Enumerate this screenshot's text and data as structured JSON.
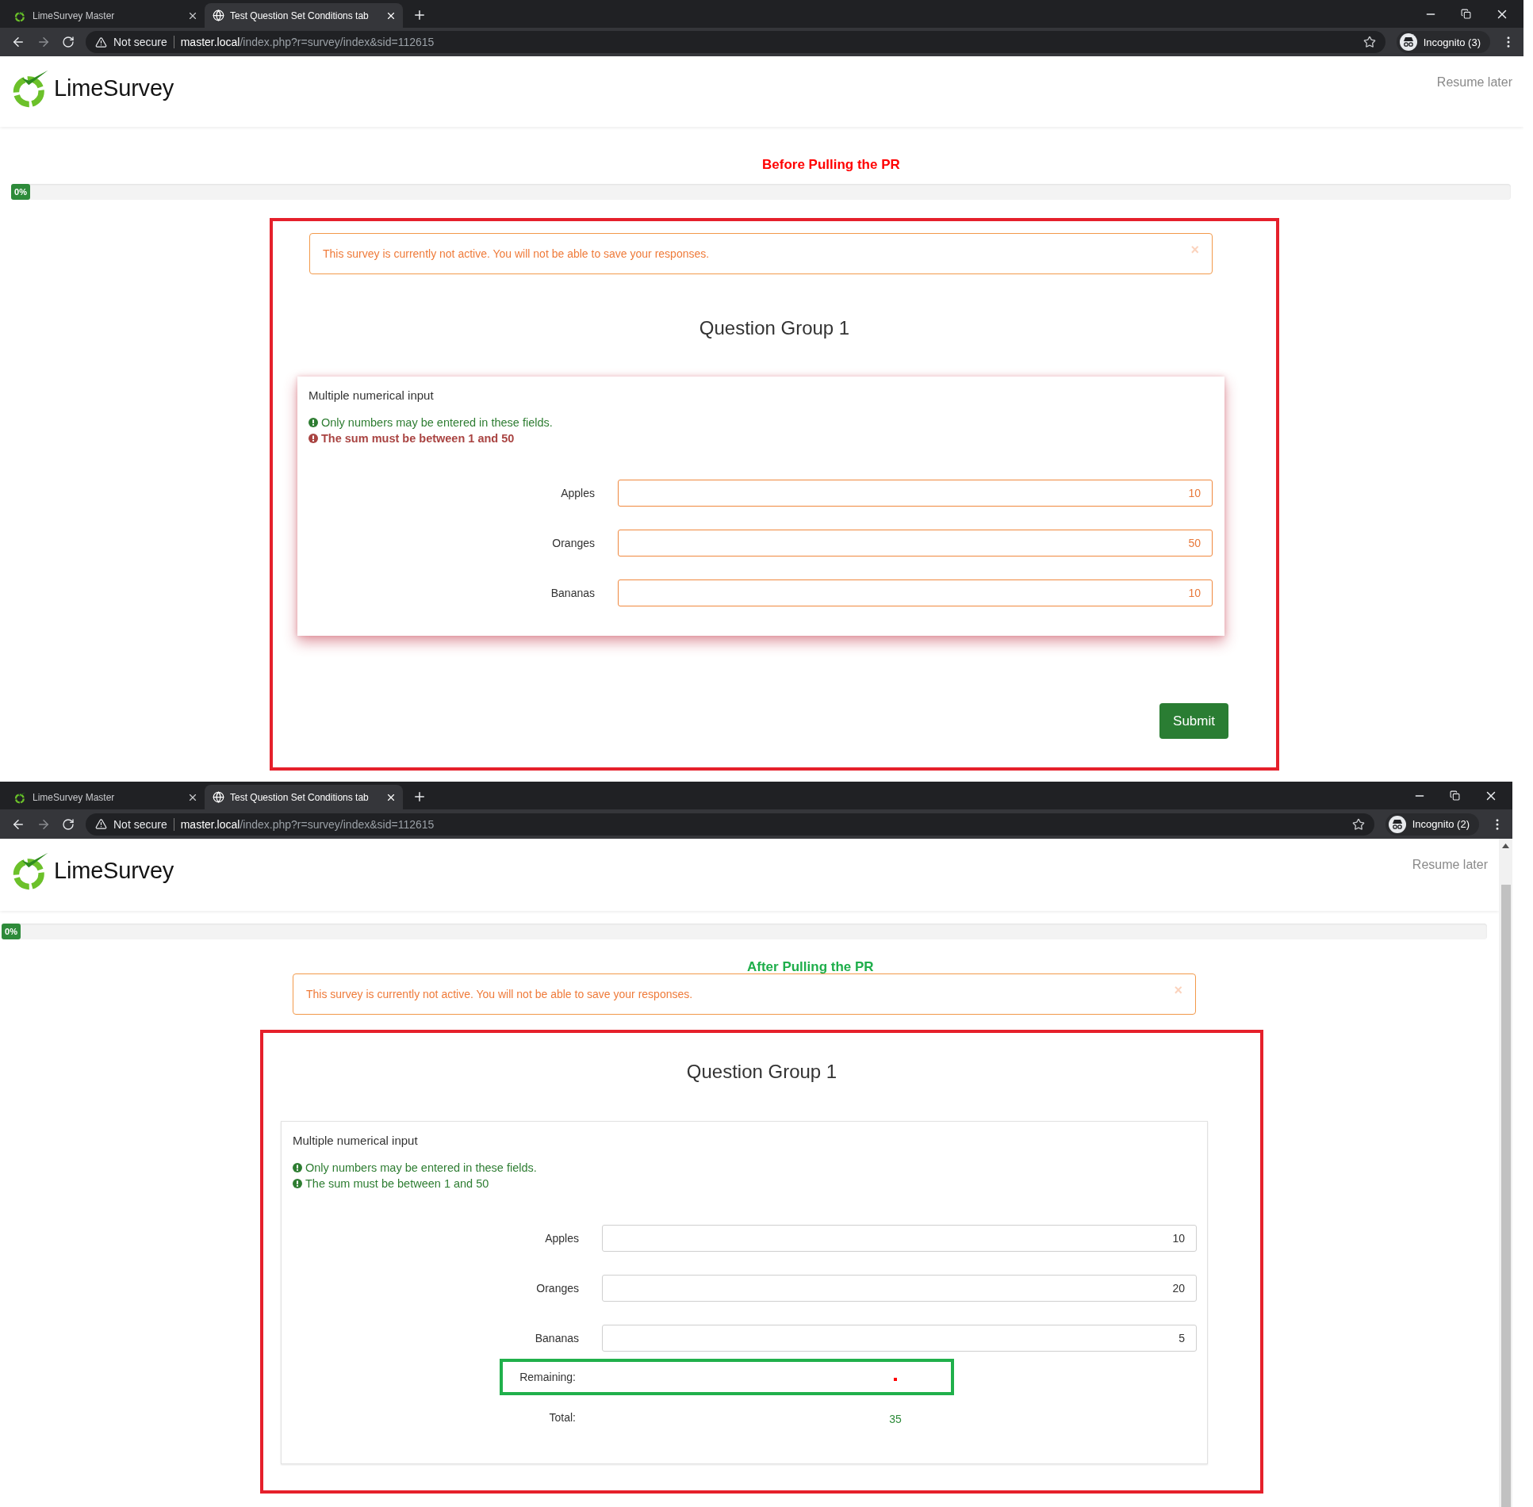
{
  "panels": [
    {
      "kind": "before",
      "browser": {
        "tabs": [
          {
            "title": "LimeSurvey Master",
            "selected": false
          },
          {
            "title": "Test Question Set Conditions tab",
            "selected": true
          }
        ],
        "security": "Not secure",
        "url_host": "master.local",
        "url_path": "/index.php?r=survey/index&sid=112615",
        "profile": "Incognito (3)"
      },
      "logo": "LimeSurvey",
      "resume": "Resume later",
      "caption": {
        "text": "Before Pulling the PR",
        "color": "#ff0000"
      },
      "progress": {
        "label": "0%",
        "level": 0
      },
      "alert": {
        "text": "This survey is currently not active. You will not be able to save your responses.",
        "close": "×"
      },
      "group_title": "Question Group 1",
      "question": {
        "title": "Multiple numerical input",
        "emphasized": true,
        "hints": [
          {
            "text": "Only numbers may be entered in these fields.",
            "error": false
          },
          {
            "text": "The sum must be between 1 and 50",
            "error": true
          }
        ],
        "answers": [
          {
            "label": "Apples",
            "value": "10",
            "invalid": true
          },
          {
            "label": "Oranges",
            "value": "50",
            "invalid": true
          },
          {
            "label": "Bananas",
            "value": "10",
            "invalid": true
          }
        ]
      },
      "submit": "Submit"
    },
    {
      "kind": "after",
      "browser": {
        "tabs": [
          {
            "title": "LimeSurvey Master",
            "selected": false
          },
          {
            "title": "Test Question Set Conditions tab",
            "selected": true
          }
        ],
        "security": "Not secure",
        "url_host": "master.local",
        "url_path": "/index.php?r=survey/index&sid=112615",
        "profile": "Incognito (2)"
      },
      "logo": "LimeSurvey",
      "resume": "Resume later",
      "caption": {
        "text": "After Pulling the PR",
        "color": "#1fae4b"
      },
      "progress": {
        "label": "0%",
        "level": 0
      },
      "alert": {
        "text": "This survey is currently not active. You will not be able to save your responses.",
        "close": "×"
      },
      "group_title": "Question Group 1",
      "question": {
        "title": "Multiple numerical input",
        "emphasized": false,
        "hints": [
          {
            "text": "Only numbers may be entered in these fields.",
            "error": false
          },
          {
            "text": "The sum must be between 1 and 50",
            "error": false
          }
        ],
        "answers": [
          {
            "label": "Apples",
            "value": "10",
            "invalid": false
          },
          {
            "label": "Oranges",
            "value": "20",
            "invalid": false
          },
          {
            "label": "Bananas",
            "value": "5",
            "invalid": false
          }
        ],
        "totals": [
          {
            "kind": "remaining",
            "label": "Remaining:",
            "highlighted": true
          },
          {
            "kind": "total",
            "label": "Total:",
            "value": "35",
            "highlighted": false
          }
        ]
      }
    }
  ]
}
